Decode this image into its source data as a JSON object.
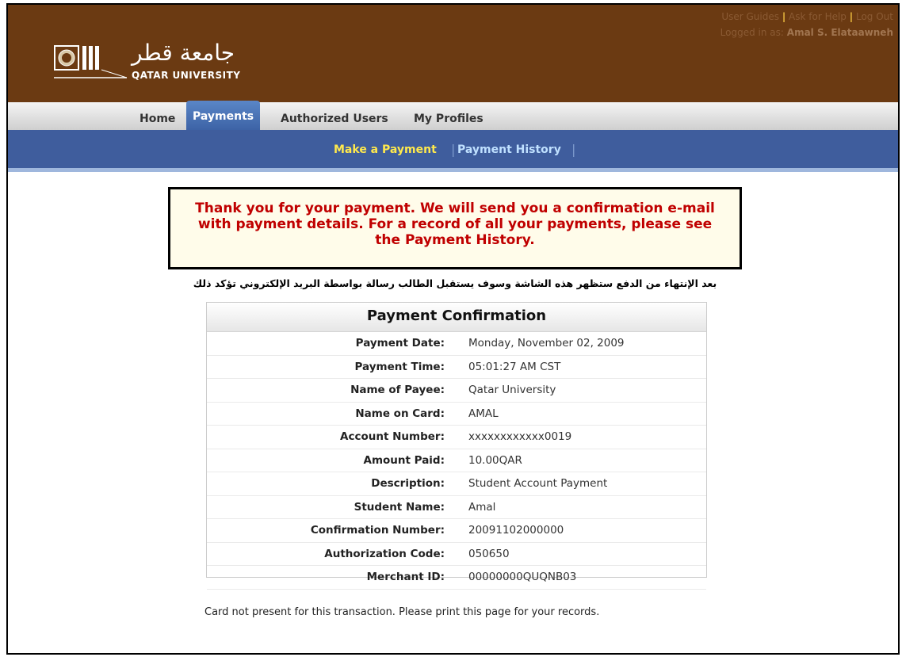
{
  "header": {
    "logo": {
      "arabic": "جامعة قطر",
      "english": "QATAR UNIVERSITY"
    },
    "links": {
      "user_guides": "User Guides",
      "ask_help": "Ask for Help",
      "log_out": "Log Out",
      "separator": "|"
    },
    "login": {
      "label": "Logged in as:",
      "user": "Amal S. Elataawneh"
    },
    "colors": {
      "brand_brown": "#6b3a12",
      "accent_yellow": "#f5c542"
    }
  },
  "nav": {
    "tabs": [
      {
        "label": "Home",
        "active": false
      },
      {
        "label": "Payments",
        "active": true
      },
      {
        "label": "Authorized Users",
        "active": false
      },
      {
        "label": "My Profiles",
        "active": false
      }
    ]
  },
  "subnav": {
    "items": [
      {
        "label": "Make a Payment",
        "color": "#ffe94d",
        "active": true
      },
      {
        "label": "Payment History",
        "color": "#bfe0ff",
        "active": false
      }
    ],
    "separator": "|"
  },
  "message": {
    "line1": "Thank you for your payment. We will send you a confirmation e-mail",
    "line2": "with payment details. For a record of all your payments, please see",
    "line3": "the Payment History.",
    "color": "#c00000"
  },
  "arabic_note": "بعد الإنتهاء من الدفع ستظهر هذه الشاشة وسوف يستقبل الطالب رسالة بواسطة البريد الإلكتروني تؤكد ذلك",
  "confirmation": {
    "title": "Payment Confirmation",
    "rows": [
      {
        "label": "Payment Date:",
        "value": "Monday, November 02, 2009"
      },
      {
        "label": "Payment Time:",
        "value": "05:01:27 AM CST"
      },
      {
        "label": "Name of Payee:",
        "value": "Qatar University"
      },
      {
        "label": "Name on Card:",
        "value": "AMAL"
      },
      {
        "label": "Account Number:",
        "value": "xxxxxxxxxxxx0019"
      },
      {
        "label": "Amount Paid:",
        "value": "10.00QAR"
      },
      {
        "label": "Description:",
        "value": "Student Account Payment"
      },
      {
        "label": "Student Name:",
        "value": "Amal"
      },
      {
        "label": "Confirmation Number:",
        "value": "20091102000000"
      },
      {
        "label": "Authorization Code:",
        "value": "050650"
      },
      {
        "label": "Merchant ID:",
        "value": "00000000QUQNB03"
      }
    ]
  },
  "footnote": "Card not present for this transaction. Please print this page for your records."
}
